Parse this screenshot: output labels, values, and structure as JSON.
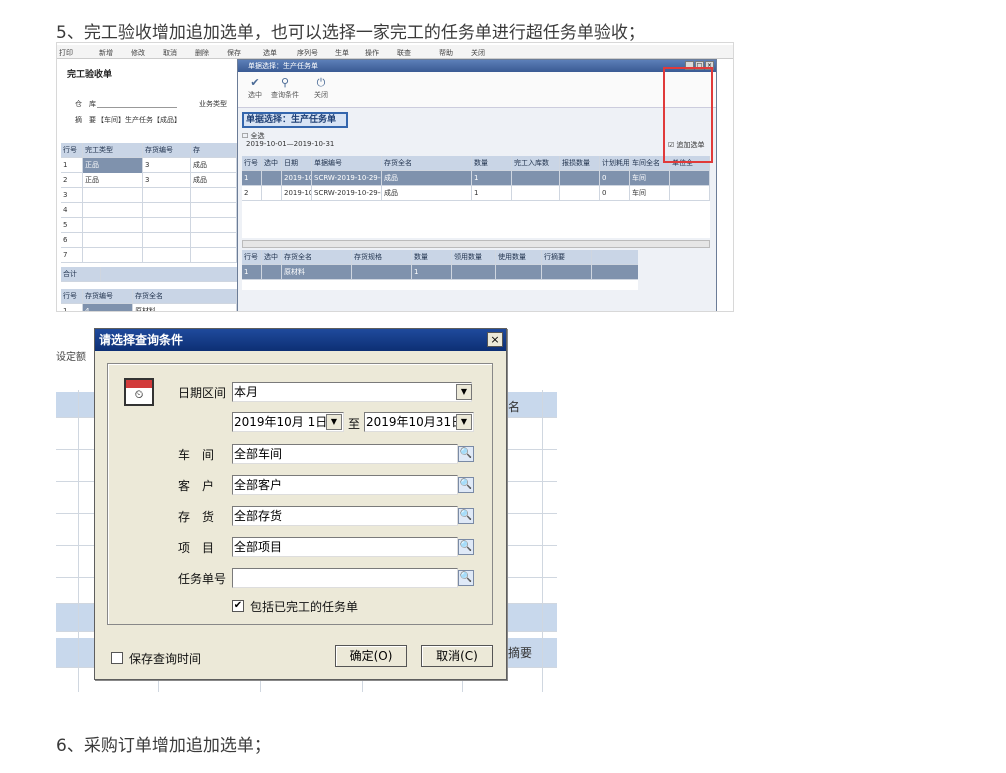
{
  "heading5": "5、完工验收增加追加选单，也可以选择一家完工的任务单进行超任务单验收；",
  "heading6": "6、采购订单增加追加选单；",
  "shot1": {
    "toolbar": [
      "打印",
      "新增",
      "修改",
      "取消",
      "删除",
      "保存",
      "选单",
      "序列号",
      "生单",
      "操作",
      "联查",
      "帮助",
      "关闭"
    ],
    "form_title": "完工验收单",
    "warehouse_label": "仓　库",
    "biz_type_label": "业务类型",
    "memo_label": "摘　要",
    "memo_value": "【车间】生产任务【成品】",
    "grid_headers": [
      "行号",
      "完工类型",
      "存货编号",
      "存"
    ],
    "grid_rows": [
      [
        "1",
        "正品",
        "3",
        "成品"
      ],
      [
        "2",
        "正品",
        "3",
        "成品"
      ],
      [
        "3",
        "",
        "",
        ""
      ],
      [
        "4",
        "",
        "",
        ""
      ],
      [
        "5",
        "",
        "",
        ""
      ],
      [
        "6",
        "",
        "",
        ""
      ],
      [
        "7",
        "",
        "",
        ""
      ]
    ],
    "total_label": "合计",
    "sub_headers": [
      "行号",
      "存货编号",
      "存货全名"
    ],
    "sub_rows": [
      [
        "1",
        "4",
        "原材料"
      ]
    ],
    "dialog": {
      "title": "单据选择：生产任务单",
      "btn_select": "选中",
      "btn_query": "查询条件",
      "btn_close": "关闭",
      "bill_select": "单据选择：生产任务单",
      "select_all": "全选",
      "date_range": "2019-10-01—2019-10-31",
      "append_select": "追加选单",
      "upper_headers": [
        "行号",
        "选中",
        "日期",
        "单据编号",
        "存货全名",
        "数量",
        "完工入库数",
        "报损数量",
        "计划耗用",
        "车间全名",
        "单位全"
      ],
      "upper_rows": [
        [
          "1",
          "",
          "2019-10-29",
          "SCRW-2019-10-29-(",
          "成品",
          "1",
          "",
          "",
          "0",
          "车间",
          ""
        ],
        [
          "2",
          "",
          "2019-10-29",
          "SCRW-2019-10-29-(",
          "成品",
          "1",
          "",
          "",
          "0",
          "车间",
          ""
        ]
      ],
      "lower_headers": [
        "行号",
        "选中",
        "存货全名",
        "存货规格",
        "数量",
        "领用数量",
        "使用数量",
        "行摘要"
      ],
      "lower_rows": [
        [
          "1",
          "",
          "原材料",
          "",
          "1",
          "",
          "",
          ""
        ]
      ]
    }
  },
  "shot2": {
    "bg_left_text": "设定额",
    "bg_name_col": "名",
    "bg_memo_col": "摘要",
    "title": "请选择查询条件",
    "date_range_label": "日期区间",
    "date_range_value": "本月",
    "date_from": "2019年10月 1日",
    "to_label": "至",
    "date_to": "2019年10月31日",
    "workshop_label": "车　间",
    "workshop_value": "全部车间",
    "customer_label": "客　户",
    "customer_value": "全部客户",
    "stock_label": "存　货",
    "stock_value": "全部存货",
    "project_label": "项　目",
    "project_value": "全部项目",
    "task_label": "任务单号",
    "task_value": "",
    "include_done": "包括已完工的任务单",
    "save_time": "保存查询时间",
    "ok": "确定(O)",
    "cancel": "取消(C)"
  }
}
